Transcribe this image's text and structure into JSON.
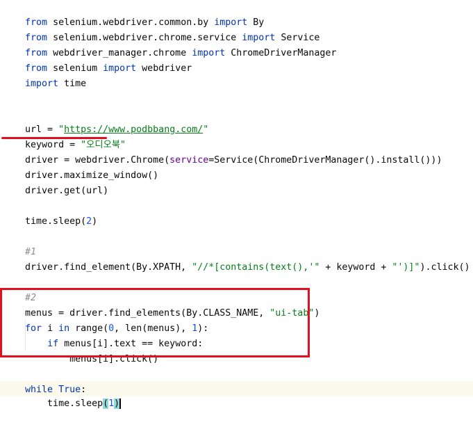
{
  "code": {
    "l1": {
      "t1": "from",
      "t2": " selenium.webdriver.common.by ",
      "t3": "import",
      "t4": " By"
    },
    "l2": {
      "t1": "from",
      "t2": " selenium.webdriver.chrome.service ",
      "t3": "import",
      "t4": " Service"
    },
    "l3": {
      "t1": "from",
      "t2": " webdriver_manager.chrome ",
      "t3": "import",
      "t4": " ChromeDriverManager"
    },
    "l4": {
      "t1": "from",
      "t2": " selenium ",
      "t3": "import",
      "t4": " webdriver"
    },
    "l5": {
      "t1": "import",
      "t2": " time"
    },
    "l8": {
      "t1": "url = ",
      "t2": "\"",
      "t3": "https://www.podbbang.com/",
      "t4": "\""
    },
    "l9": {
      "t1": "keyword = ",
      "t2": "\"오디오북\""
    },
    "l10": {
      "t1": "driver = webdriver.Chrome(",
      "t2": "service",
      "t3": "=Service(ChromeDriverManager().install()))"
    },
    "l11": {
      "t1": "driver.maximize_window()"
    },
    "l12": {
      "t1": "driver.get(url)"
    },
    "l14": {
      "t1": "time.sleep(",
      "t2": "2",
      "t3": ")"
    },
    "l16": {
      "t1": "#1"
    },
    "l17": {
      "t1": "driver.find_element(By.XPATH, ",
      "t2": "\"//*[contains(text(),'\"",
      "t3": " + keyword + ",
      "t4": "\"')]\"",
      "t5": ").click()"
    },
    "l19": {
      "t1": "#2"
    },
    "l20": {
      "t1": "menus = driver.find_elements(By.CLASS_NAME, ",
      "t2": "\"ui-tab\"",
      "t3": ")"
    },
    "l21": {
      "t1": "for",
      "t2": " i ",
      "t3": "in",
      "t4": " range(",
      "t5": "0",
      "t6": ", len(menus), ",
      "t7": "1",
      "t8": "):"
    },
    "l22": {
      "t1": "    ",
      "t2": "if",
      "t3": " menus[i].text == keyword:"
    },
    "l23": {
      "t1": "        menus[i].click()"
    },
    "l25": {
      "t1": "while",
      "t2": " ",
      "t3": "True",
      "t4": ":"
    },
    "l26": {
      "t1": "    time.sleep",
      "t2": "(",
      "t3": "1",
      "t4": ")"
    }
  },
  "colors": {
    "keyword": "#0033b3",
    "string": "#067d17",
    "number": "#1750eb",
    "comment": "#8c8c8c",
    "parameter": "#660099",
    "annotation_red": "#e0101e",
    "current_line": "#fcfaed"
  }
}
